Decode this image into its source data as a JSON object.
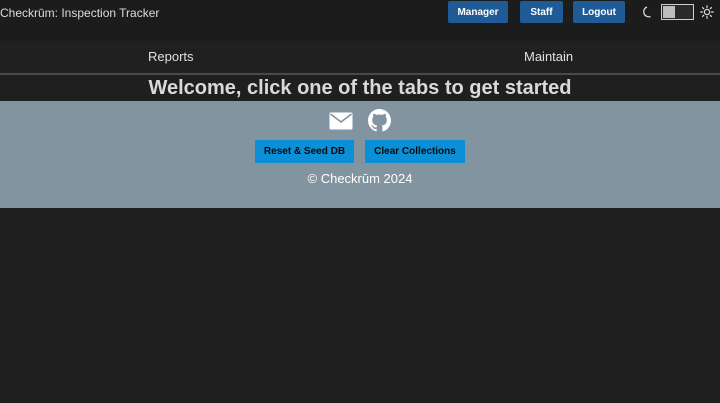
{
  "header": {
    "app_title": "Checkrūm: Inspection Tracker",
    "buttons": {
      "manager": "Manager",
      "staff": "Staff",
      "logout": "Logout"
    },
    "theme_toggle": {
      "left_icon": "moon-icon",
      "right_icon": "sun-icon"
    }
  },
  "tabs": [
    {
      "label": "Reports"
    },
    {
      "label": "Maintain"
    }
  ],
  "main": {
    "welcome": "Welcome, click one of the tabs to get started"
  },
  "footer": {
    "icons": [
      "mail-icon",
      "github-icon"
    ],
    "reset_button": "Reset & Seed DB",
    "clear_button": "Clear Collections",
    "copyright": "© Checkrūm 2024"
  },
  "colors": {
    "background": "#1f1f1f",
    "header_button": "#1f5c97",
    "footer_bg": "#82949f",
    "footer_button": "#0b8fd6"
  }
}
